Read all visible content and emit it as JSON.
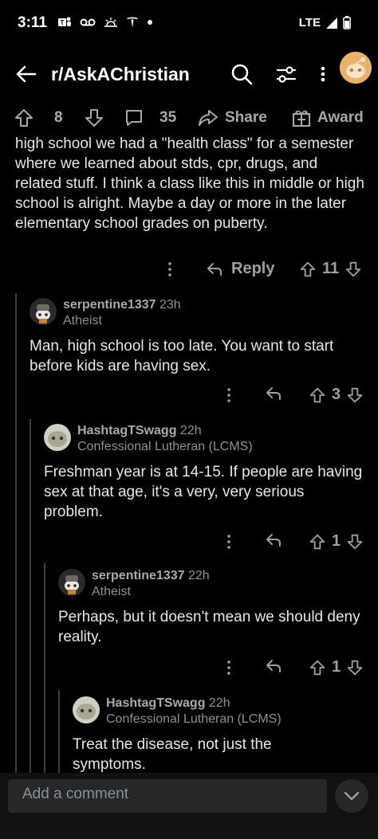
{
  "status": {
    "time": "3:11",
    "network": "LTE"
  },
  "header": {
    "subreddit": "r/AskAChristian"
  },
  "post_actions": {
    "upvotes": "8",
    "comments": "35",
    "share_label": "Share",
    "award_label": "Award"
  },
  "top_comment": {
    "text": "high school we had a \"health class\" for a semester where we learned about stds, cpr, drugs, and related stuff. I think a class like this in middle or high school is alright. Maybe a day or more in the later elementary school grades on puberty.",
    "reply_label": "Reply",
    "votes": "11"
  },
  "comments": [
    {
      "username": "serpentine1337",
      "time": "23h",
      "flair": "Atheist",
      "body": "Man, high school is too late.  You want to start before kids are having sex.",
      "votes": "3"
    },
    {
      "username": "HashtagTSwagg",
      "time": "22h",
      "flair": "Confessional Lutheran (LCMS)",
      "body": "Freshman year is at 14-15. If people are having sex at that age, it's a very, very serious problem.",
      "votes": "1"
    },
    {
      "username": "serpentine1337",
      "time": "22h",
      "flair": "Atheist",
      "body": "Perhaps, but it doesn't mean we should deny reality.",
      "votes": "1"
    },
    {
      "username": "HashtagTSwagg",
      "time": "22h",
      "flair": "Confessional Lutheran (LCMS)",
      "body": "Treat the disease, not just the symptoms."
    }
  ],
  "composer": {
    "placeholder": "Add a comment"
  },
  "colors": {
    "background": "#000000",
    "text": "#e4e6e7",
    "muted": "#9aa0a4"
  }
}
